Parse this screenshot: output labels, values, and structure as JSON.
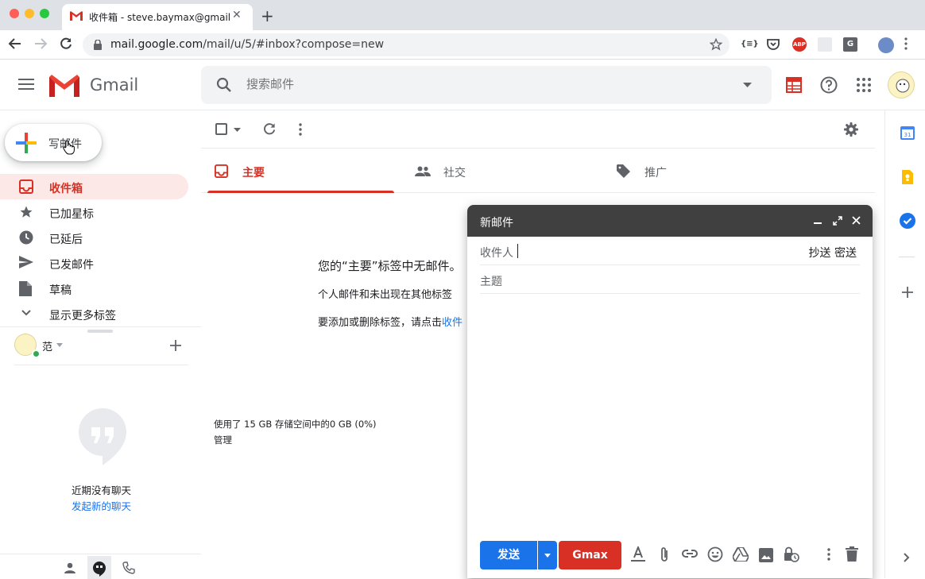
{
  "browser": {
    "tab_title": "收件箱 - steve.baymax@gmail.com",
    "url_host": "mail.google.com",
    "url_path": "/mail/u/5/#inbox?compose=new",
    "ext_json_label": "{≡}",
    "ext_abp_label": "ABP",
    "ext_g_label": "G"
  },
  "header": {
    "app_name": "Gmail",
    "search_placeholder": "搜索邮件"
  },
  "sidebar": {
    "compose_label": "写邮件",
    "items": [
      {
        "label": "收件箱",
        "icon": "inbox-icon",
        "active": true
      },
      {
        "label": "已加星标",
        "icon": "star-icon"
      },
      {
        "label": "已延后",
        "icon": "clock-icon"
      },
      {
        "label": "已发邮件",
        "icon": "send-icon"
      },
      {
        "label": "草稿",
        "icon": "draft-icon"
      },
      {
        "label": "显示更多标签",
        "icon": "chevron-down-icon"
      }
    ],
    "hangouts_user": "范",
    "no_chats": "近期没有聊天",
    "start_chat": "发起新的聊天"
  },
  "main": {
    "tabs": [
      {
        "label": "主要",
        "icon": "inbox-icon"
      },
      {
        "label": "社交",
        "icon": "people-icon"
      },
      {
        "label": "推广",
        "icon": "tag-icon"
      }
    ],
    "empty_title": "您的“主要”标签中无邮件。",
    "empty_line1": "个人邮件和未出现在其他标签",
    "empty_line2_text": "要添加或删除标签，请点击",
    "empty_line2_link": "收件",
    "storage": "使用了 15 GB 存储空间中的0 GB (0%)",
    "manage": "管理"
  },
  "compose": {
    "title": "新邮件",
    "to_label": "收件人",
    "cc_bcc": "抄送 密送",
    "subject_label": "主题",
    "send_label": "发送",
    "gmax_label": "Gmax"
  },
  "colors": {
    "gmail_red": "#d93025",
    "send_blue": "#1a73e8",
    "compose_header": "#404040"
  }
}
